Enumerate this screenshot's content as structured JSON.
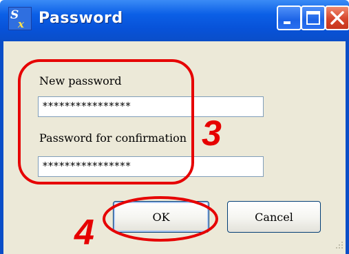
{
  "window": {
    "title": "Password",
    "app_icon": "sx-app-icon",
    "controls": [
      "minimize-icon",
      "maximize-icon",
      "close-icon"
    ]
  },
  "form": {
    "new_password_label": "New password",
    "new_password_value": "****************",
    "confirm_label": "Password for confirmation",
    "confirm_value": "****************"
  },
  "buttons": {
    "ok_label": "OK",
    "cancel_label": "Cancel"
  },
  "annotations": {
    "step_3": "3",
    "step_4": "4",
    "color": "#e60000"
  },
  "colors": {
    "titlebar": "#0a4ec8",
    "client_bg": "#ece9d8",
    "close_button": "#d6452b"
  }
}
